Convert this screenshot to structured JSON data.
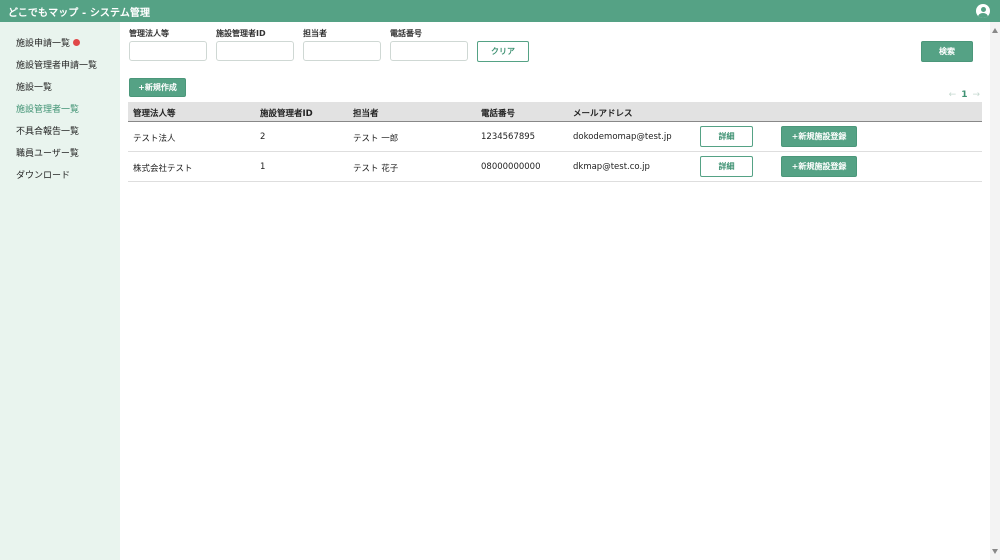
{
  "header": {
    "title": "どこでもマップ - システム管理"
  },
  "sidebar": {
    "items": [
      {
        "label": "施設申請一覧",
        "badge": true
      },
      {
        "label": "施設管理者申請一覧"
      },
      {
        "label": "施設一覧"
      },
      {
        "label": "施設管理者一覧",
        "active": true
      },
      {
        "label": "不具合報告一覧"
      },
      {
        "label": "職員ユーザー覧"
      },
      {
        "label": "ダウンロード"
      }
    ]
  },
  "filters": {
    "corp": {
      "label": "管理法人等",
      "value": ""
    },
    "admin_id": {
      "label": "施設管理者ID",
      "value": ""
    },
    "person": {
      "label": "担当者",
      "value": ""
    },
    "phone": {
      "label": "電話番号",
      "value": ""
    },
    "clear_label": "クリア",
    "search_label": "検索"
  },
  "new_button_label": "+新規作成",
  "pagination": {
    "prev": "←",
    "page": "1",
    "next": "→"
  },
  "table": {
    "headers": [
      "管理法人等",
      "施設管理者ID",
      "担当者",
      "電話番号",
      "メールアドレス"
    ],
    "rows": [
      {
        "corp": "テスト法人",
        "id": "2",
        "person": "テスト 一郎",
        "phone": "1234567895",
        "email": "dokodemomap@test.jp",
        "detail": "詳細",
        "register": "+新規施設登録"
      },
      {
        "corp": "株式会社テスト",
        "id": "1",
        "person": "テスト 花子",
        "phone": "08000000000",
        "email": "dkmap@test.co.jp",
        "detail": "詳細",
        "register": "+新規施設登録"
      }
    ]
  },
  "colors": {
    "primary": "#55a285",
    "sidebar_bg": "#e9f4ee",
    "badge": "#e04848"
  },
  "icons": {
    "avatar": "user-avatar-icon"
  }
}
